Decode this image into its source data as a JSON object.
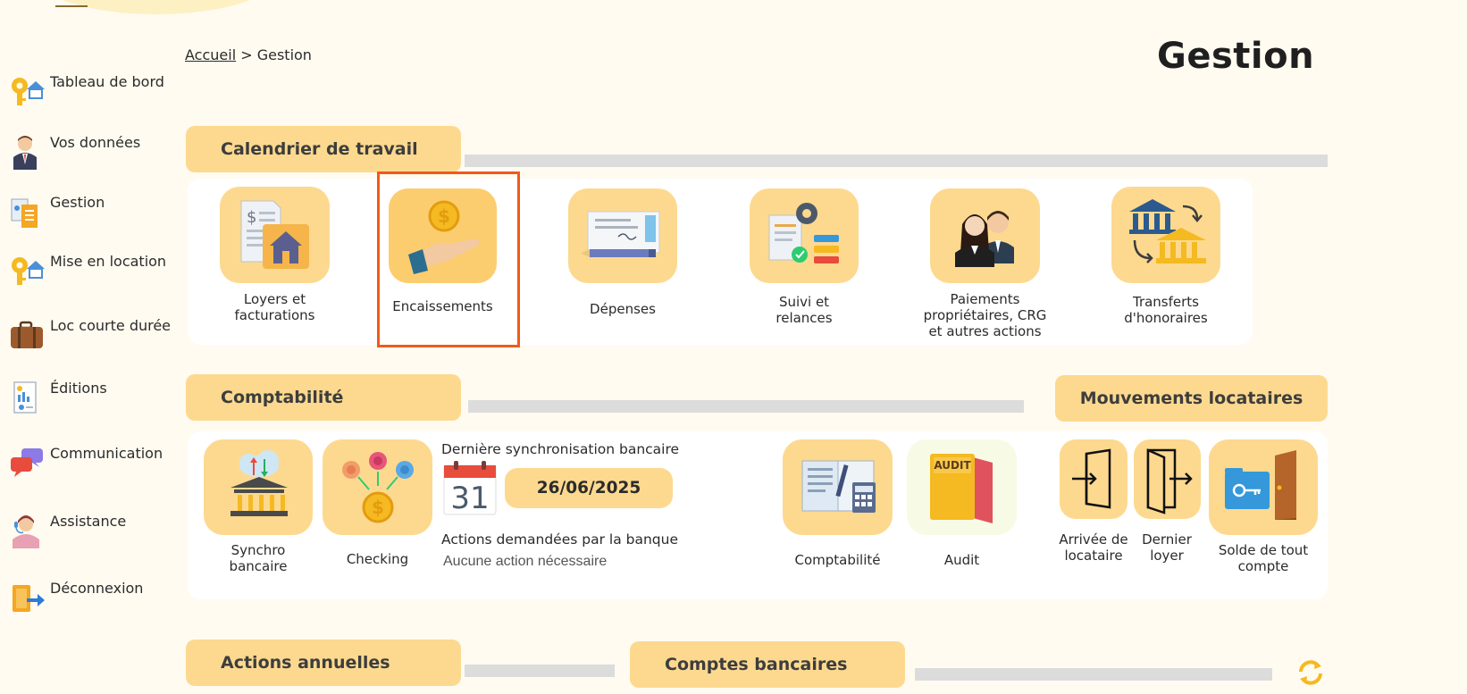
{
  "sidebar": {
    "items": [
      {
        "label": "Tableau de bord",
        "icon": "key-house-icon"
      },
      {
        "label": "Vos données",
        "icon": "user-icon"
      },
      {
        "label": "Gestion",
        "icon": "documents-icon"
      },
      {
        "label": "Mise en location",
        "icon": "key-house-icon"
      },
      {
        "label": "Loc courte durée",
        "icon": "suitcase-icon"
      },
      {
        "label": "Éditions",
        "icon": "report-icon"
      },
      {
        "label": "Communication",
        "icon": "chat-bubbles-icon"
      },
      {
        "label": "Assistance",
        "icon": "support-agent-icon"
      },
      {
        "label": "Déconnexion",
        "icon": "logout-icon"
      }
    ]
  },
  "breadcrumb": {
    "home": "Accueil",
    "separator": " > ",
    "current": "Gestion"
  },
  "page_title": "Gestion",
  "sections": {
    "calendrier": {
      "title": "Calendrier de travail",
      "tiles": [
        {
          "label_lines": [
            "Loyers et",
            "facturations"
          ],
          "icon": "rent-invoice-icon"
        },
        {
          "label_lines": [
            "Encaissements"
          ],
          "icon": "hand-coin-icon"
        },
        {
          "label_lines": [
            "Dépenses"
          ],
          "icon": "cheque-pen-icon"
        },
        {
          "label_lines": [
            "Suivi et",
            "relances"
          ],
          "icon": "gear-checklist-icon"
        },
        {
          "label_lines": [
            "Paiements",
            "propriétaires, CRG",
            "et autres actions"
          ],
          "icon": "owners-icon"
        },
        {
          "label_lines": [
            "Transferts",
            "d'honoraires"
          ],
          "icon": "bank-transfer-icon"
        }
      ]
    },
    "comptabilite": {
      "title": "Comptabilité",
      "tiles": [
        {
          "label_lines": [
            "Synchro",
            "bancaire"
          ],
          "icon": "bank-sync-icon"
        },
        {
          "label_lines": [
            "Checking"
          ],
          "icon": "coins-network-icon"
        },
        {
          "label_lines": [
            "Comptabilité"
          ],
          "icon": "ledger-calculator-icon"
        },
        {
          "label_lines": [
            "Audit"
          ],
          "icon": "audit-folder-icon"
        }
      ],
      "sync": {
        "title": "Dernière synchronisation bancaire",
        "calendar_day": "31",
        "date": "26/06/2025",
        "bank_actions_title": "Actions demandées par la banque",
        "bank_actions_status": "Aucune action nécessaire"
      }
    },
    "mouvements": {
      "title": "Mouvements locataires",
      "tiles": [
        {
          "label_lines": [
            "Arrivée de",
            "locataire"
          ],
          "icon": "door-enter-icon"
        },
        {
          "label_lines": [
            "Dernier",
            "loyer"
          ],
          "icon": "door-exit-icon"
        },
        {
          "label_lines": [
            "Solde de tout",
            "compte"
          ],
          "icon": "key-door-icon"
        }
      ]
    },
    "actions_annuelles": {
      "title": "Actions annuelles"
    },
    "comptes_bancaires": {
      "title": "Comptes bancaires"
    }
  },
  "colors": {
    "accent": "#fdd98f",
    "background": "#fffbf0",
    "highlight": "#f05a1a"
  }
}
